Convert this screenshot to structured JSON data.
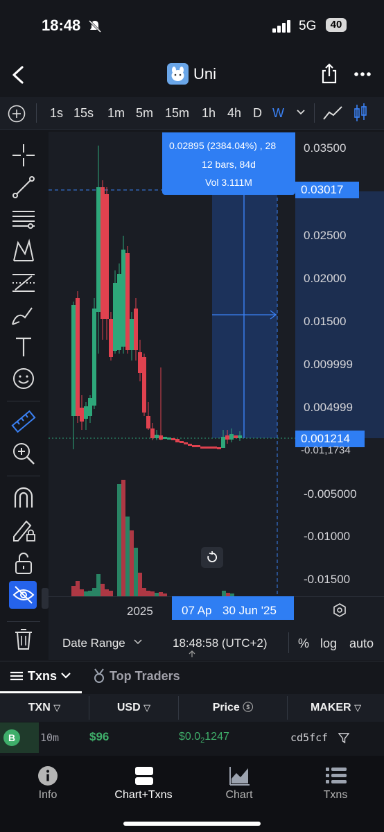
{
  "status_bar": {
    "time": "18:48",
    "network": "5G",
    "battery": "40"
  },
  "header": {
    "title": "Uni"
  },
  "timeframes": [
    "1s",
    "15s",
    "1m",
    "5m",
    "15m",
    "1h",
    "4h",
    "D",
    "W"
  ],
  "active_timeframe": "W",
  "chart": {
    "price_axis": [
      "0.03500",
      "0.02500",
      "0.02000",
      "0.01500",
      "0.009999",
      "0.004999",
      "-0.005000",
      "-0.01000",
      "-0.01500"
    ],
    "current_price": "0.001214",
    "measure_price": "0.03017",
    "partial_label": "-0.01,1734",
    "tooltip": {
      "line1": "0.02895 (2384.04%) , 28",
      "line2": "12 bars, 84d",
      "line3": "Vol 3.111M"
    },
    "x_axis": {
      "year": "2025",
      "start": "07 Ap",
      "end": "30 Jun '25"
    },
    "footer": {
      "date_range": "Date Range",
      "clock": "18:48:58 (UTC+2)",
      "percent": "%",
      "log": "log",
      "auto": "auto"
    }
  },
  "bottom_tabs": {
    "txns": "Txns",
    "top_traders": "Top Traders"
  },
  "table": {
    "headers": [
      "TXN",
      "USD",
      "Price",
      "MAKER"
    ],
    "rows": [
      {
        "badge": "B",
        "age": "10m",
        "usd": "$96",
        "price_prefix": "$0.0",
        "price_sub": "2",
        "price_rest": "1247",
        "maker": "cd5fcf"
      }
    ]
  },
  "nav": [
    {
      "label": "Info",
      "icon": "info-icon"
    },
    {
      "label": "Chart+Txns",
      "icon": "chart-txns-icon"
    },
    {
      "label": "Chart",
      "icon": "chart-icon"
    },
    {
      "label": "Txns",
      "icon": "list-icon"
    }
  ],
  "colors": {
    "up": "#2ea77a",
    "down": "#e0424f",
    "accent": "#3b82f6",
    "buy": "#3fae6a"
  }
}
